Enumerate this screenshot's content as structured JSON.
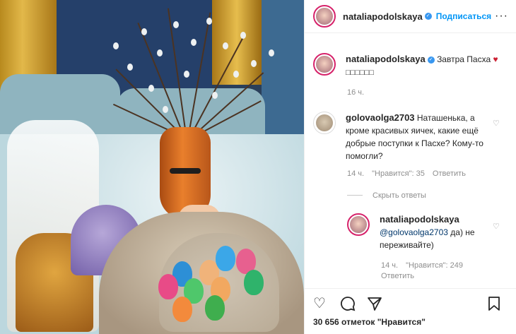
{
  "author": {
    "username": "nataliapodolskaya",
    "follow_label": "Подписаться",
    "more_icon": "more-options-icon"
  },
  "caption": {
    "username": "nataliapodolskaya",
    "text": "Завтра Пасха",
    "emoji_row": "□□□□□□",
    "time": "16 ч."
  },
  "comment1": {
    "username": "golovaolga2703",
    "text": "Наташенька, а кроме красивых яичек, какие ещё добрые поступки к Пасхе? Кому-то помогли?",
    "time": "14 ч.",
    "likes": "\"Нравится\": 35",
    "reply_label": "Ответить",
    "hide_replies": "Скрыть ответы"
  },
  "reply1": {
    "username": "nataliapodolskaya",
    "mention": "@golovaolga2703",
    "text": " да) не переживайте)",
    "time": "14 ч.",
    "likes": "\"Нравится\": 249",
    "reply_label": "Ответить"
  },
  "footer": {
    "likes_text": "30 656 отметок \"Нравится\""
  },
  "colors": {
    "accent": "#0095f6",
    "story_ring": "#d6226a"
  }
}
